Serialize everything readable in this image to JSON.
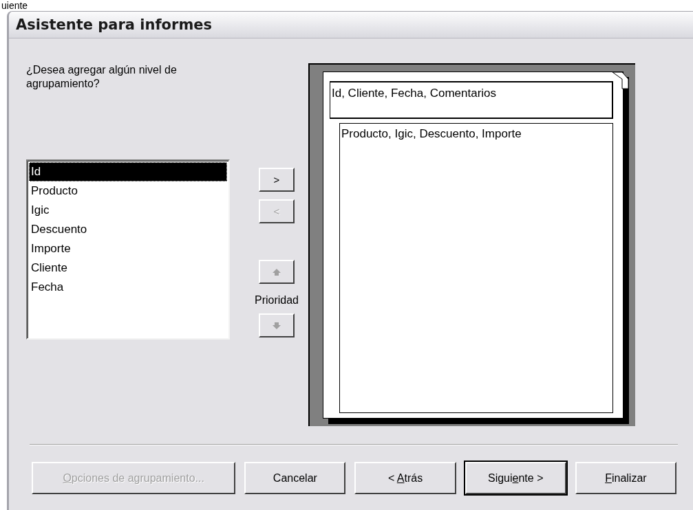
{
  "heading_fragment": "uiente",
  "window": {
    "title": "Asistente para informes"
  },
  "question": "¿Desea agregar algún nivel de agrupamiento?",
  "fields": [
    {
      "label": "Id",
      "selected": true
    },
    {
      "label": "Producto",
      "selected": false
    },
    {
      "label": "Igic",
      "selected": false
    },
    {
      "label": "Descuento",
      "selected": false
    },
    {
      "label": "Importe",
      "selected": false
    },
    {
      "label": "Cliente",
      "selected": false
    },
    {
      "label": "Fecha",
      "selected": false
    }
  ],
  "move_buttons": [
    {
      "label": ">",
      "disabled": false
    },
    {
      "label": "<",
      "disabled": true
    }
  ],
  "priority": {
    "label": "Prioridad",
    "up_disabled": true,
    "down_disabled": true
  },
  "preview": {
    "header": "Id, Cliente, Fecha, Comentarios",
    "detail": "Producto, Igic, Descuento, Importe"
  },
  "buttons": [
    {
      "label_parts": {
        "underlined": "O",
        "after": "pciones de agrupamiento..."
      },
      "disabled": true,
      "default": false
    },
    {
      "label": "Cancelar",
      "disabled": false,
      "default": false
    },
    {
      "label_parts": {
        "before": "< ",
        "underlined": "A",
        "after": "trás"
      },
      "disabled": false,
      "default": false
    },
    {
      "label_parts": {
        "before": "Sigui",
        "underlined": "e",
        "after": "nte >"
      },
      "disabled": false,
      "default": true
    },
    {
      "label_parts": {
        "underlined": "F",
        "after": "inalizar"
      },
      "disabled": false,
      "default": false
    }
  ]
}
